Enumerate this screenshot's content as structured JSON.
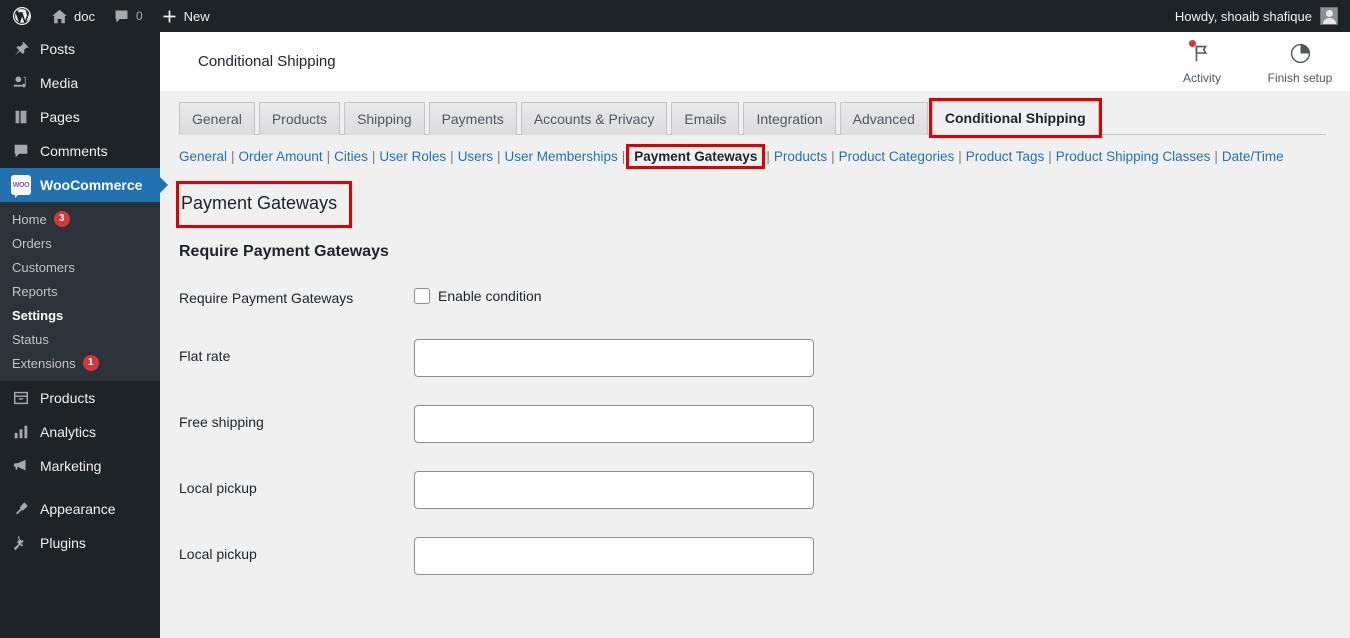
{
  "adminbar": {
    "site_name": "doc",
    "comment_count": "0",
    "new_label": "New",
    "greeting": "Howdy, shoaib shafique"
  },
  "sidebar": {
    "items": [
      {
        "label": "Posts",
        "icon": "pin-icon",
        "current": false
      },
      {
        "label": "Media",
        "icon": "media-icon",
        "current": false
      },
      {
        "label": "Pages",
        "icon": "pages-icon",
        "current": false
      },
      {
        "label": "Comments",
        "icon": "comments-icon",
        "current": false
      },
      {
        "label": "WooCommerce",
        "icon": "woocommerce-icon",
        "current": true
      },
      {
        "label": "Products",
        "icon": "products-icon",
        "current": false
      },
      {
        "label": "Analytics",
        "icon": "analytics-icon",
        "current": false
      },
      {
        "label": "Marketing",
        "icon": "marketing-icon",
        "current": false
      },
      {
        "label": "Appearance",
        "icon": "appearance-icon",
        "current": false
      },
      {
        "label": "Plugins",
        "icon": "plugins-icon",
        "current": false
      }
    ],
    "submenu": [
      {
        "label": "Home",
        "badge": "3",
        "current": false
      },
      {
        "label": "Orders",
        "badge": "",
        "current": false
      },
      {
        "label": "Customers",
        "badge": "",
        "current": false
      },
      {
        "label": "Reports",
        "badge": "",
        "current": false
      },
      {
        "label": "Settings",
        "badge": "",
        "current": true
      },
      {
        "label": "Status",
        "badge": "",
        "current": false
      },
      {
        "label": "Extensions",
        "badge": "1",
        "current": false
      }
    ]
  },
  "header": {
    "title": "Conditional Shipping",
    "activity_label": "Activity",
    "finish_setup_label": "Finish setup"
  },
  "tabs": [
    {
      "label": "General",
      "active": false,
      "highlighted": false
    },
    {
      "label": "Products",
      "active": false,
      "highlighted": false
    },
    {
      "label": "Shipping",
      "active": false,
      "highlighted": false
    },
    {
      "label": "Payments",
      "active": false,
      "highlighted": false
    },
    {
      "label": "Accounts & Privacy",
      "active": false,
      "highlighted": false
    },
    {
      "label": "Emails",
      "active": false,
      "highlighted": false
    },
    {
      "label": "Integration",
      "active": false,
      "highlighted": false
    },
    {
      "label": "Advanced",
      "active": false,
      "highlighted": false
    },
    {
      "label": "Conditional Shipping",
      "active": true,
      "highlighted": true
    }
  ],
  "subnav": [
    {
      "label": "General",
      "current": false
    },
    {
      "label": "Order Amount",
      "current": false
    },
    {
      "label": "Cities",
      "current": false
    },
    {
      "label": "User Roles",
      "current": false
    },
    {
      "label": "Users",
      "current": false
    },
    {
      "label": "User Memberships",
      "current": false
    },
    {
      "label": "Payment Gateways",
      "current": true
    },
    {
      "label": "Products",
      "current": false
    },
    {
      "label": "Product Categories",
      "current": false
    },
    {
      "label": "Product Tags",
      "current": false
    },
    {
      "label": "Product Shipping Classes",
      "current": false
    },
    {
      "label": "Date/Time",
      "current": false
    }
  ],
  "main": {
    "section_title": "Payment Gateways",
    "sub_title": "Require Payment Gateways",
    "enable_row": {
      "label": "Require Payment Gateways",
      "checkbox_label": "Enable condition",
      "checked": false
    },
    "method_rows": [
      {
        "label": "Flat rate",
        "value": "",
        "placeholder": ""
      },
      {
        "label": "Free shipping",
        "value": "",
        "placeholder": ""
      },
      {
        "label": "Local pickup",
        "value": "",
        "placeholder": ""
      },
      {
        "label": "Local pickup",
        "value": "",
        "placeholder": ""
      }
    ]
  },
  "colors": {
    "admin_bar": "#1d2327",
    "sidebar": "#1d2327",
    "accent_blue": "#2271b1",
    "link_blue": "#2271b1",
    "badge_red": "#d63638",
    "highlight_red": "#e00000",
    "content_bg": "#f0f0f1"
  }
}
